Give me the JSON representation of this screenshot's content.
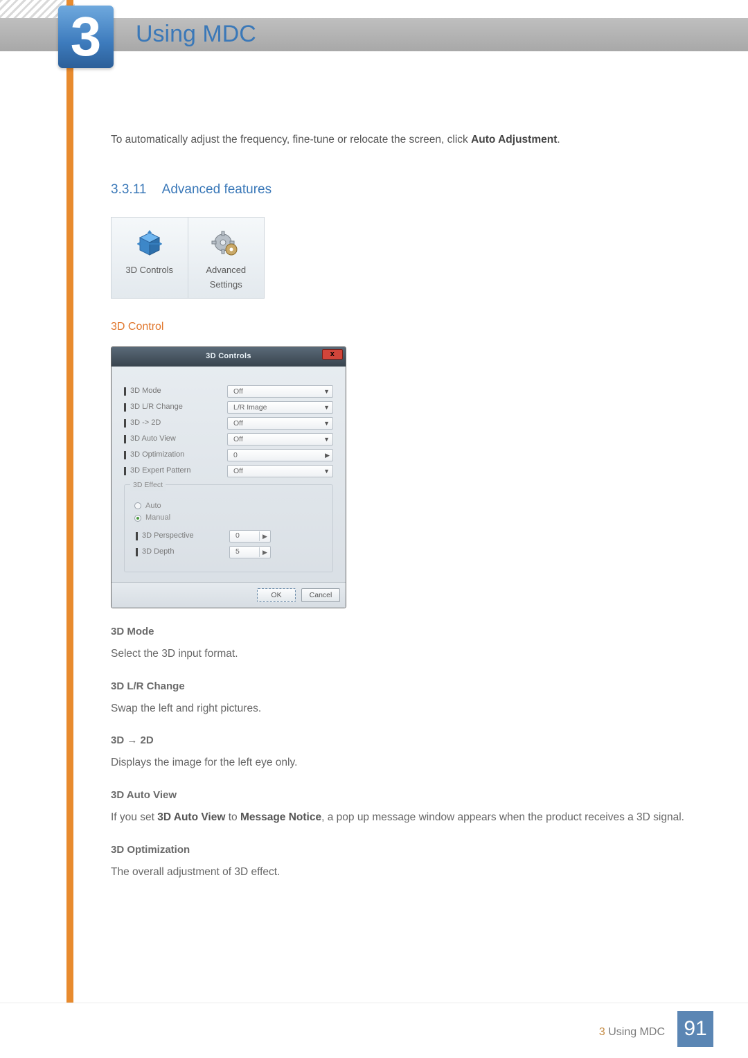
{
  "header": {
    "chapter_number": "3",
    "chapter_title": "Using MDC"
  },
  "intro": {
    "pre": "To automatically adjust the frequency, fine-tune or relocate the screen, click ",
    "bold": "Auto Adjustment",
    "post": "."
  },
  "section": {
    "number": "3.3.11",
    "title": "Advanced features"
  },
  "tiles": {
    "a": "3D Controls",
    "b": "Advanced Settings"
  },
  "subhead_3d_control": "3D Control",
  "dialog": {
    "title": "3D Controls",
    "close": "x",
    "rows": {
      "mode": {
        "label": "3D Mode",
        "value": "Off"
      },
      "lr": {
        "label": "3D L/R Change",
        "value": "L/R Image"
      },
      "to2d": {
        "label": "3D -> 2D",
        "value": "Off"
      },
      "autoview": {
        "label": "3D Auto View",
        "value": "Off"
      },
      "opt": {
        "label": "3D Optimization",
        "value": "0"
      },
      "expert": {
        "label": "3D Expert Pattern",
        "value": "Off"
      }
    },
    "effect": {
      "legend": "3D Effect",
      "auto": "Auto",
      "manual": "Manual",
      "perspective": {
        "label": "3D Perspective",
        "value": "0"
      },
      "depth": {
        "label": "3D Depth",
        "value": "5"
      }
    },
    "buttons": {
      "ok": "OK",
      "cancel": "Cancel"
    }
  },
  "items": {
    "mode": {
      "title": "3D Mode",
      "desc": "Select the 3D input format."
    },
    "lr": {
      "title": "3D L/R Change",
      "desc": "Swap the left and right pictures."
    },
    "to2d": {
      "title": "3D → 2D",
      "desc": "Displays the image for the left eye only."
    },
    "autoview": {
      "title": "3D Auto View",
      "desc_pre": "If you set ",
      "desc_b1": "3D Auto View",
      "desc_mid": " to ",
      "desc_b2": "Message Notice",
      "desc_post": ", a pop up message window appears when the product receives a 3D signal."
    },
    "opt": {
      "title": "3D Optimization",
      "desc": "The overall adjustment of 3D effect."
    }
  },
  "footer": {
    "label_num": "3",
    "label_text": "Using MDC",
    "page": "91"
  }
}
